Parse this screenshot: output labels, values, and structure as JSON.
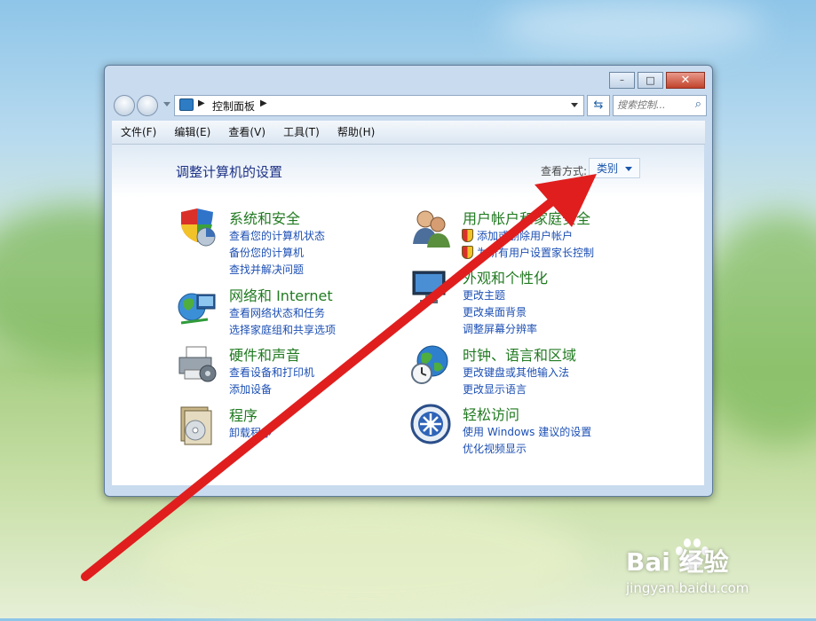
{
  "address": {
    "crumb": "控制面板"
  },
  "search": {
    "placeholder": "搜索控制..."
  },
  "menu": [
    "文件(F)",
    "编辑(E)",
    "查看(V)",
    "工具(T)",
    "帮助(H)"
  ],
  "window_buttons": {
    "minimize": "–",
    "maximize": "□",
    "close": "✕"
  },
  "main": {
    "title": "调整计算机的设置",
    "view_label": "查看方式:",
    "view_value": "类别"
  },
  "categories_left": [
    {
      "title": "系统和安全",
      "icon": "system-security-icon",
      "links": [
        "查看您的计算机状态",
        "备份您的计算机",
        "查找并解决问题"
      ]
    },
    {
      "title": "网络和 Internet",
      "icon": "network-icon",
      "links": [
        "查看网络状态和任务",
        "选择家庭组和共享选项"
      ]
    },
    {
      "title": "硬件和声音",
      "icon": "printer-icon",
      "links": [
        "查看设备和打印机",
        "添加设备"
      ]
    },
    {
      "title": "程序",
      "icon": "programs-icon",
      "links": [
        "卸载程序"
      ]
    }
  ],
  "categories_right": [
    {
      "title": "用户帐户和家庭安全",
      "icon": "users-icon",
      "links": [
        "添加或删除用户帐户",
        "为所有用户设置家长控制"
      ]
    },
    {
      "title": "外观和个性化",
      "icon": "monitor-icon",
      "links": [
        "更改主题",
        "更改桌面背景",
        "调整屏幕分辨率"
      ]
    },
    {
      "title": "时钟、语言和区域",
      "icon": "globe-clock-icon",
      "links": [
        "更改键盘或其他输入法",
        "更改显示语言"
      ]
    },
    {
      "title": "轻松访问",
      "icon": "ease-of-access-icon",
      "links": [
        "使用 Windows 建议的设置",
        "优化视频显示"
      ]
    }
  ],
  "watermark": {
    "brand": "Bai  经验",
    "url": "jingyan.baidu.com"
  },
  "colors": {
    "title_blue": "#1e3287",
    "category_green": "#217a21",
    "link_blue": "#1c4fb4",
    "arrow_red": "#e01e1e"
  }
}
